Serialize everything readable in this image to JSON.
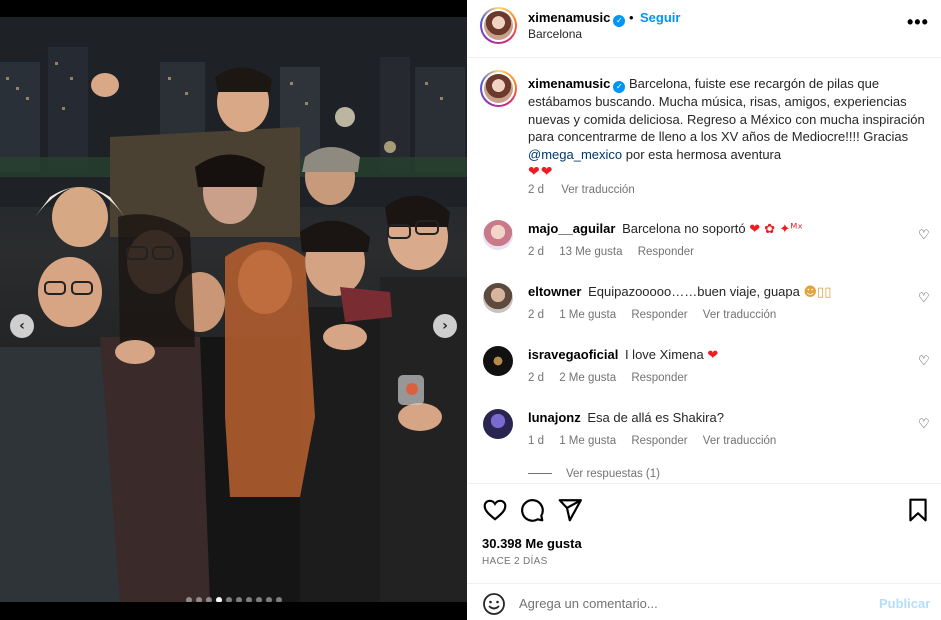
{
  "post": {
    "username": "ximenamusic",
    "separator": "•",
    "follow_label": "Seguir",
    "location": "Barcelona",
    "more_label": "•••"
  },
  "caption": {
    "username": "ximenamusic",
    "text": "Barcelona, fuiste ese recargón de pilas que estábamos buscando. Mucha música, risas, amigos, experiencias nuevas y comida deliciosa. Regreso a México con mucha inspiración para concentrarme de lleno a los XV años de Mediocre!!!! Gracias",
    "mention": "@mega_mexico",
    "text_after": "por esta hermosa aventura",
    "emojis": "❤❤",
    "time": "2 d",
    "translate_label": "Ver traducción"
  },
  "comments": [
    {
      "username": "majo__aguilar",
      "text": "Barcelona no soportó",
      "emoji": "❤ ✿ ✦ᴹˣ",
      "time": "2 d",
      "likes": "13 Me gusta",
      "reply": "Responder",
      "translate": ""
    },
    {
      "username": "eltowner",
      "text": "Equipazooooo……buen viaje, guapa",
      "emoji": "☻▯▯",
      "time": "2 d",
      "likes": "1 Me gusta",
      "reply": "Responder",
      "translate": "Ver traducción"
    },
    {
      "username": "isravegaoficial",
      "text": "I love Ximena",
      "emoji": "❤",
      "time": "2 d",
      "likes": "2 Me gusta",
      "reply": "Responder",
      "translate": ""
    },
    {
      "username": "lunajonz",
      "text": "Esa de allá es Shakira?",
      "emoji": "",
      "time": "1 d",
      "likes": "1 Me gusta",
      "reply": "Responder",
      "translate": "Ver traducción"
    }
  ],
  "replies_label": "Ver respuestas (1)",
  "stats": {
    "likes": "30.398 Me gusta",
    "ago": "HACE 2 DÍAS"
  },
  "composer": {
    "placeholder": "Agrega un comentario...",
    "post_label": "Publicar"
  },
  "carousel": {
    "prev": "‹",
    "next": "›",
    "slides": 10,
    "active": 3
  },
  "colors": {
    "link": "#0095f6",
    "mention": "#00376b",
    "heart": "#ed1c24",
    "muted": "#737373"
  }
}
